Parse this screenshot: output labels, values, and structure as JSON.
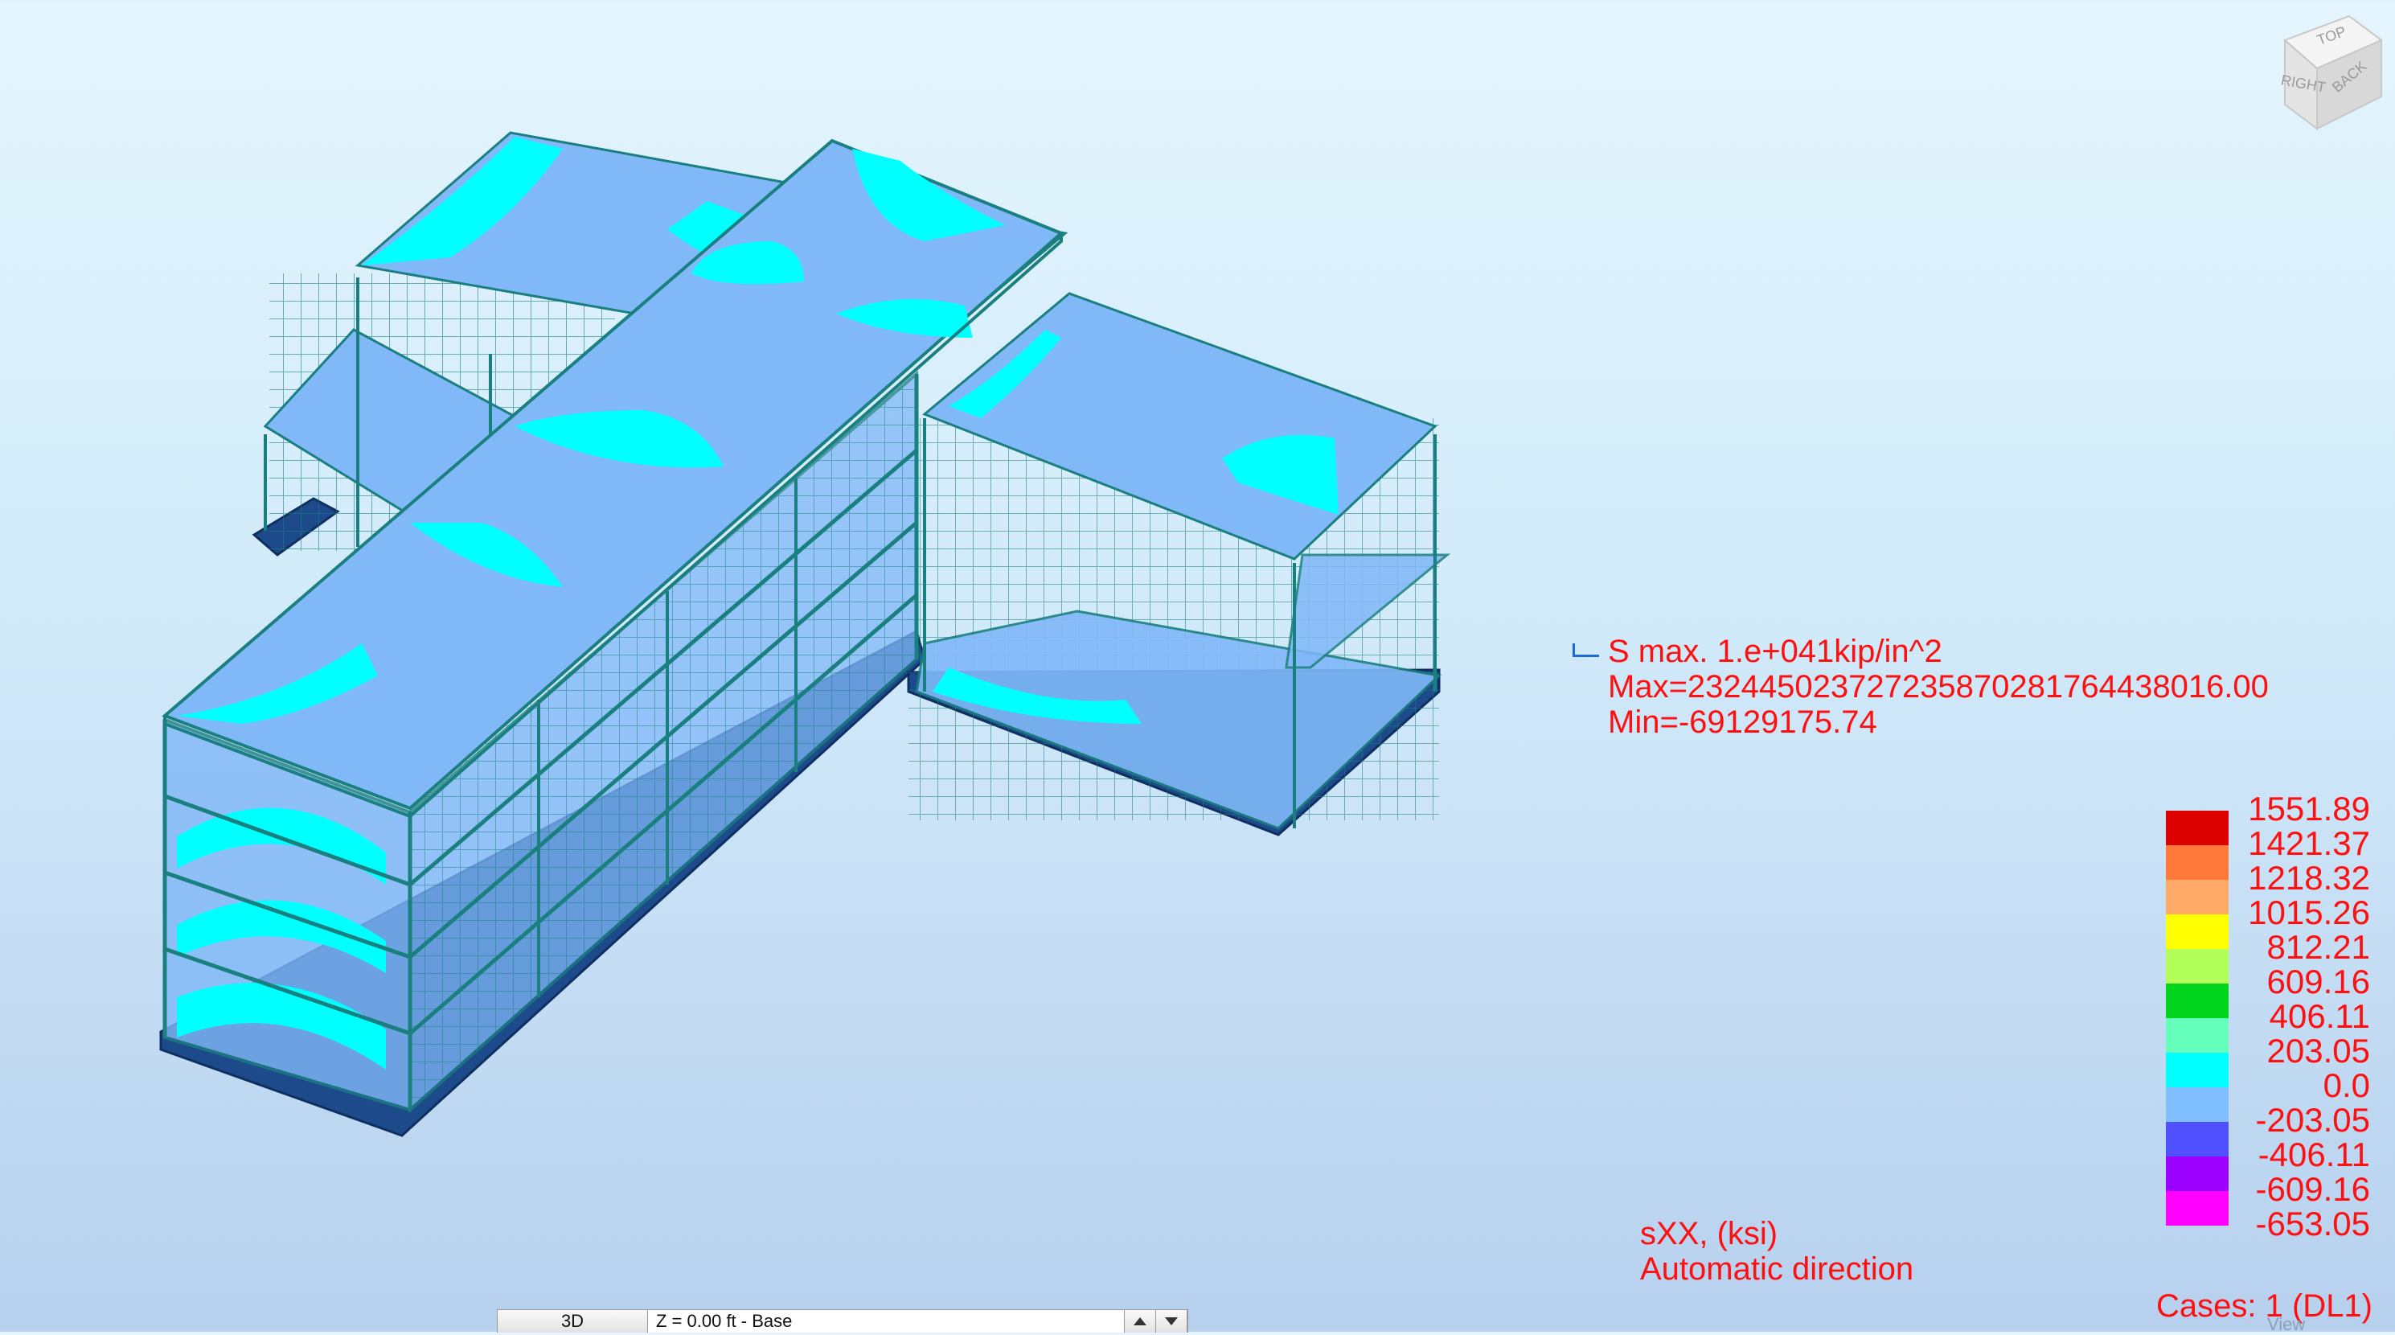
{
  "stress_info": {
    "title": "S max. 1.e+041kip/in^2",
    "max": "Max=23244502372723587028176443801​6.00",
    "min": "Min=-69129175.74"
  },
  "legend": [
    {
      "label": "1551.89",
      "color": "#dd0000"
    },
    {
      "label": "1421.37",
      "color": "#ff7a3a"
    },
    {
      "label": "1218.32",
      "color": "#ffaa66"
    },
    {
      "label": "1015.26",
      "color": "#ffff00"
    },
    {
      "label": "812.21",
      "color": "#b2ff59"
    },
    {
      "label": "609.16",
      "color": "#00d41c"
    },
    {
      "label": "406.11",
      "color": "#66ffbb"
    },
    {
      "label": "203.05",
      "color": "#00ffff"
    },
    {
      "label": "0.0",
      "color": "#7fbfff"
    },
    {
      "label": "-203.05",
      "color": "#5050ff"
    },
    {
      "label": "-406.11",
      "color": "#9b00ff"
    },
    {
      "label": "-609.16",
      "color": "#ff00ff"
    },
    {
      "label": "-653.05",
      "color": ""
    }
  ],
  "result": {
    "component": "sXX, (ksi)",
    "direction": "Automatic direction"
  },
  "cases": "Cases: 1 (DL1)",
  "viewcube": {
    "top": "TOP",
    "right": "RIGHT",
    "back": "BACK"
  },
  "status_bar": {
    "view_mode": "3D",
    "plane": "Z = 0.00 ft - Base",
    "view": "View"
  },
  "colors": {
    "slab_blue": "#80b8f8",
    "slab_cyan": "#00ffff",
    "frame": "#1a7f7f",
    "foundation": "#1c4a8a"
  }
}
